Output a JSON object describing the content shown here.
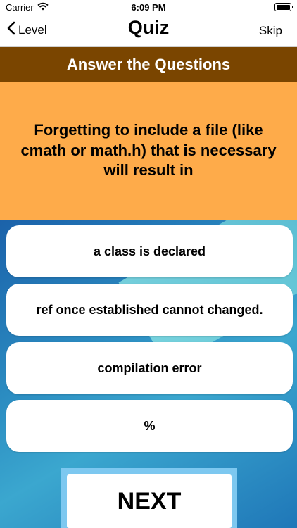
{
  "status_bar": {
    "carrier": "Carrier",
    "time": "6:09 PM"
  },
  "nav": {
    "back_label": "Level",
    "title": "Quiz",
    "skip_label": "Skip"
  },
  "header": {
    "title": "Answer the Questions"
  },
  "question": {
    "text": "Forgetting to include a file (like cmath or math.h) that is necessary will result in"
  },
  "answers": [
    {
      "label": "a class is declared"
    },
    {
      "label": "ref once established cannot changed."
    },
    {
      "label": "compilation error"
    },
    {
      "label": "%"
    }
  ],
  "next_button": {
    "label": "NEXT"
  },
  "colors": {
    "header_band": "#7a4500",
    "question_bg": "#feab4a",
    "next_frame": "#7dc8f0"
  }
}
